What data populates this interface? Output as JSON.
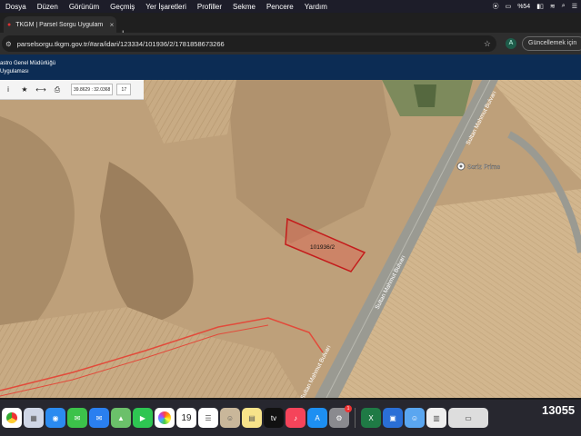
{
  "menubar": {
    "items": [
      "Dosya",
      "Düzen",
      "Görünüm",
      "Geçmiş",
      "Yer İşaretleri",
      "Profiller",
      "Sekme",
      "Pencere",
      "Yardım"
    ],
    "battery": "%54"
  },
  "tab": {
    "title": "TKGM | Parsel Sorgu Uygulam",
    "close": "×",
    "new_tab": "+"
  },
  "addressbar": {
    "url": "parselsorgu.tkgm.gov.tr/#ara/idari/123334/101936/2/1781858673266",
    "update_label": "Güncellemek için",
    "avatar": "A"
  },
  "site": {
    "line1": "astro Genel Müdürlüğü",
    "line2": "Uygulaması"
  },
  "toolbar": {
    "info": "i",
    "star": "★",
    "measure": "⟷",
    "print": "⎙",
    "coords": "39.8629 : 32.0368",
    "zoom": "17"
  },
  "map": {
    "parcel_label": "101936/2",
    "road_label_1": "Sultan Mahmut Bulvarı",
    "road_label_2": "Sultan Mahmut Bulvarı",
    "road_label_3": "Sultan Mahmut Bulvarı",
    "poi_label": "Seriz Prime"
  },
  "dock": {
    "calendar_day": "19",
    "notif_count": "1",
    "right_number": "13055"
  }
}
